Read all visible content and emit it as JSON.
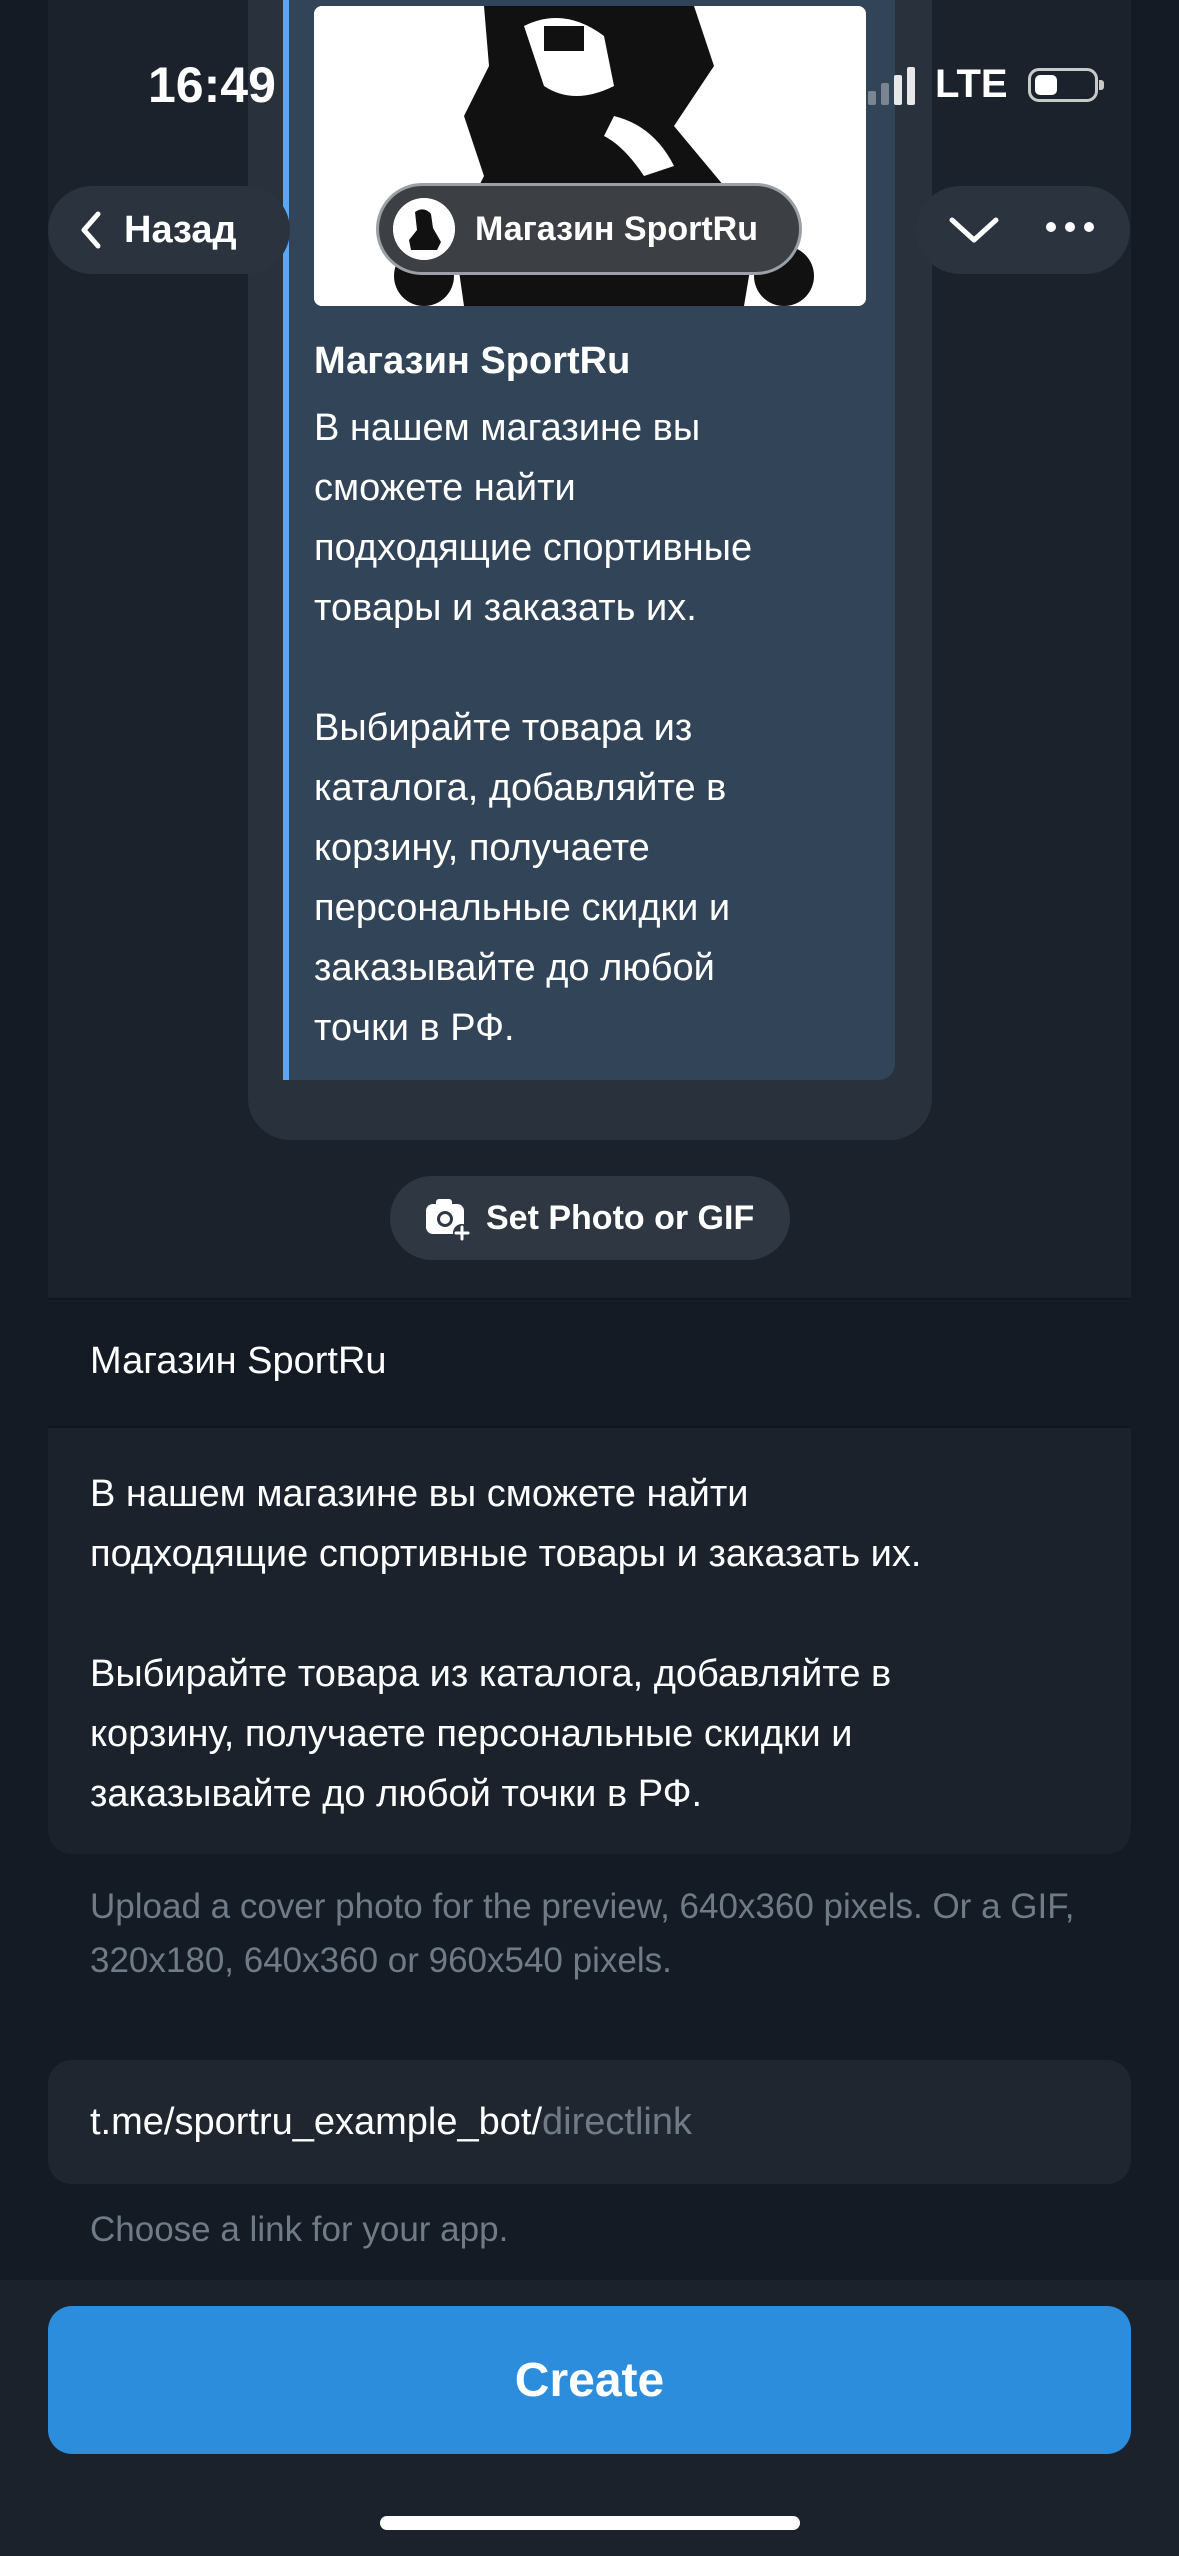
{
  "status_bar": {
    "time": "16:49",
    "network": "LTE"
  },
  "nav": {
    "back_label": "Назад",
    "back_icon": "chevron-left-icon",
    "collapse_icon": "chevron-down-icon",
    "more_icon": "more-dots-icon"
  },
  "preview": {
    "badge_label": "Магазин SportRu",
    "title": "Магазин SportRu",
    "body": "В нашем магазине вы\nсможете найти\nподходящие спортивные\nтовары и заказать их.\n\nВыбирайте товара из\nкаталога, добавляйте в\nкорзину, получаете\nперсональные скидки и\nзаказывайте до любой\nточки в РФ."
  },
  "set_photo": {
    "label": "Set Photo or GIF",
    "icon": "camera-plus-icon"
  },
  "form": {
    "name_value": "Магазин SportRu",
    "description_value": "В нашем магазине вы сможете найти\nподходящие спортивные товары и заказать их.\n\nВыбирайте товара из каталога, добавляйте в\nкорзину, получаете персональные скидки и\nзаказывайте до любой точки в РФ.",
    "cover_hint": "Upload a cover photo for the preview, 640x360 pixels. Or a GIF, 320x180, 640x360 or 960x540 pixels.",
    "link_prefix": "t.me/sportru_example_bot/",
    "link_placeholder": "directlink",
    "link_hint": "Choose a link for your app."
  },
  "actions": {
    "create_label": "Create"
  },
  "colors": {
    "accent": "#2b8ddb",
    "background": "#151b24",
    "card": "#324457"
  }
}
